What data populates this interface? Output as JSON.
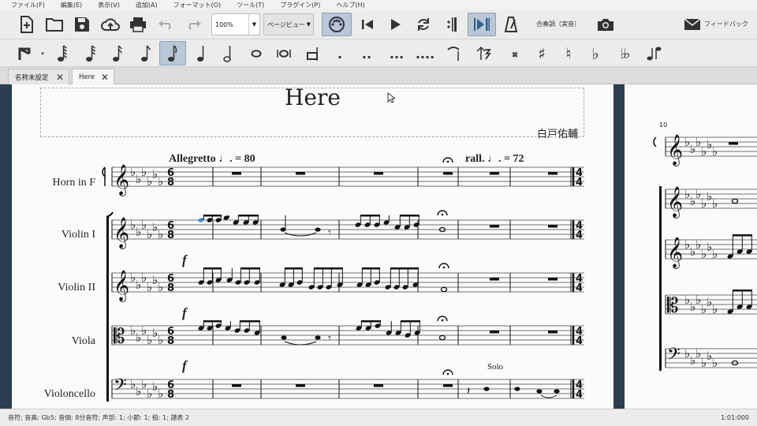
{
  "menu": [
    "ファイル(F)",
    "編集(E)",
    "表示(V)",
    "追加(A)",
    "フォーマット(O)",
    "ツール(T)",
    "プラグイン(P)",
    "ヘルプ(H)"
  ],
  "toolbar": {
    "zoom_value": "100%",
    "view_mode": "ページビュー",
    "concert_pitch_label": "合奏調（実音）",
    "feedback_label": "フィードバック",
    "voices": [
      "1",
      "2",
      "3",
      "4"
    ]
  },
  "tabs": [
    {
      "label": "名称未設定"
    },
    {
      "label": "Here"
    }
  ],
  "score": {
    "title": "Here",
    "composer": "白戸佑輔",
    "tempo_1": "Allegretto ♩. = 80",
    "tempo_2": "rall. ♩. = 72",
    "solo": "Solo",
    "dynamic": "f",
    "time_sig": [
      "6",
      "8"
    ],
    "next_time_sig": [
      "4",
      "4"
    ],
    "measure_number": "10",
    "instruments": [
      "Horn in F",
      "Violin I",
      "Violin II",
      "Viola",
      "Violoncello"
    ]
  },
  "status": {
    "left": "音符; 音高: Gb5; 音価: 8分音符; 声部: 1; 小節: 1; 拍: 1; 譜表 2",
    "right": "1:01:000"
  },
  "colors": {
    "selection": "#4a8cc2",
    "canvas_bg": "#2c3e50",
    "page_bg": "#fbfbfb"
  }
}
